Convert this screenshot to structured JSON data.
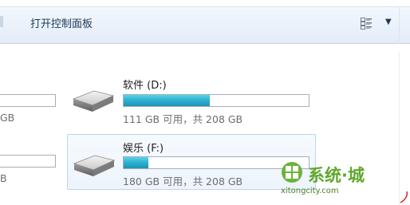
{
  "toolbar": {
    "open_control_panel_label": "打开控制面板",
    "view_dropdown_glyph": "▼",
    "icons": [
      "view-options-icon",
      "chevron-down-icon"
    ]
  },
  "left_partial_drives": [
    {
      "free_text_fragment": "GB",
      "fill_fraction": 0
    },
    {
      "free_text_fragment": "B",
      "fill_fraction": 0
    }
  ],
  "drives": [
    {
      "name": "软件 (D:)",
      "free_text": "111 GB 可用，共 208 GB",
      "free_gb": 111,
      "total_gb": 208,
      "used_fraction": 0.466,
      "selected": false,
      "icon": "hard-drive-icon"
    },
    {
      "name": "娱乐 (F:)",
      "free_text": "180 GB 可用，共 208 GB",
      "free_gb": 180,
      "total_gb": 208,
      "used_fraction": 0.135,
      "selected": true,
      "icon": "hard-drive-icon"
    }
  ],
  "colors": {
    "bar_fill": "#2fb2d2",
    "toolbar_bg": "#e3ecf7",
    "selection_border": "#bdd6f0",
    "watermark_green": "#5fa82c"
  },
  "watermark": {
    "brand": "系统·城",
    "url": "xitongcity.com"
  }
}
